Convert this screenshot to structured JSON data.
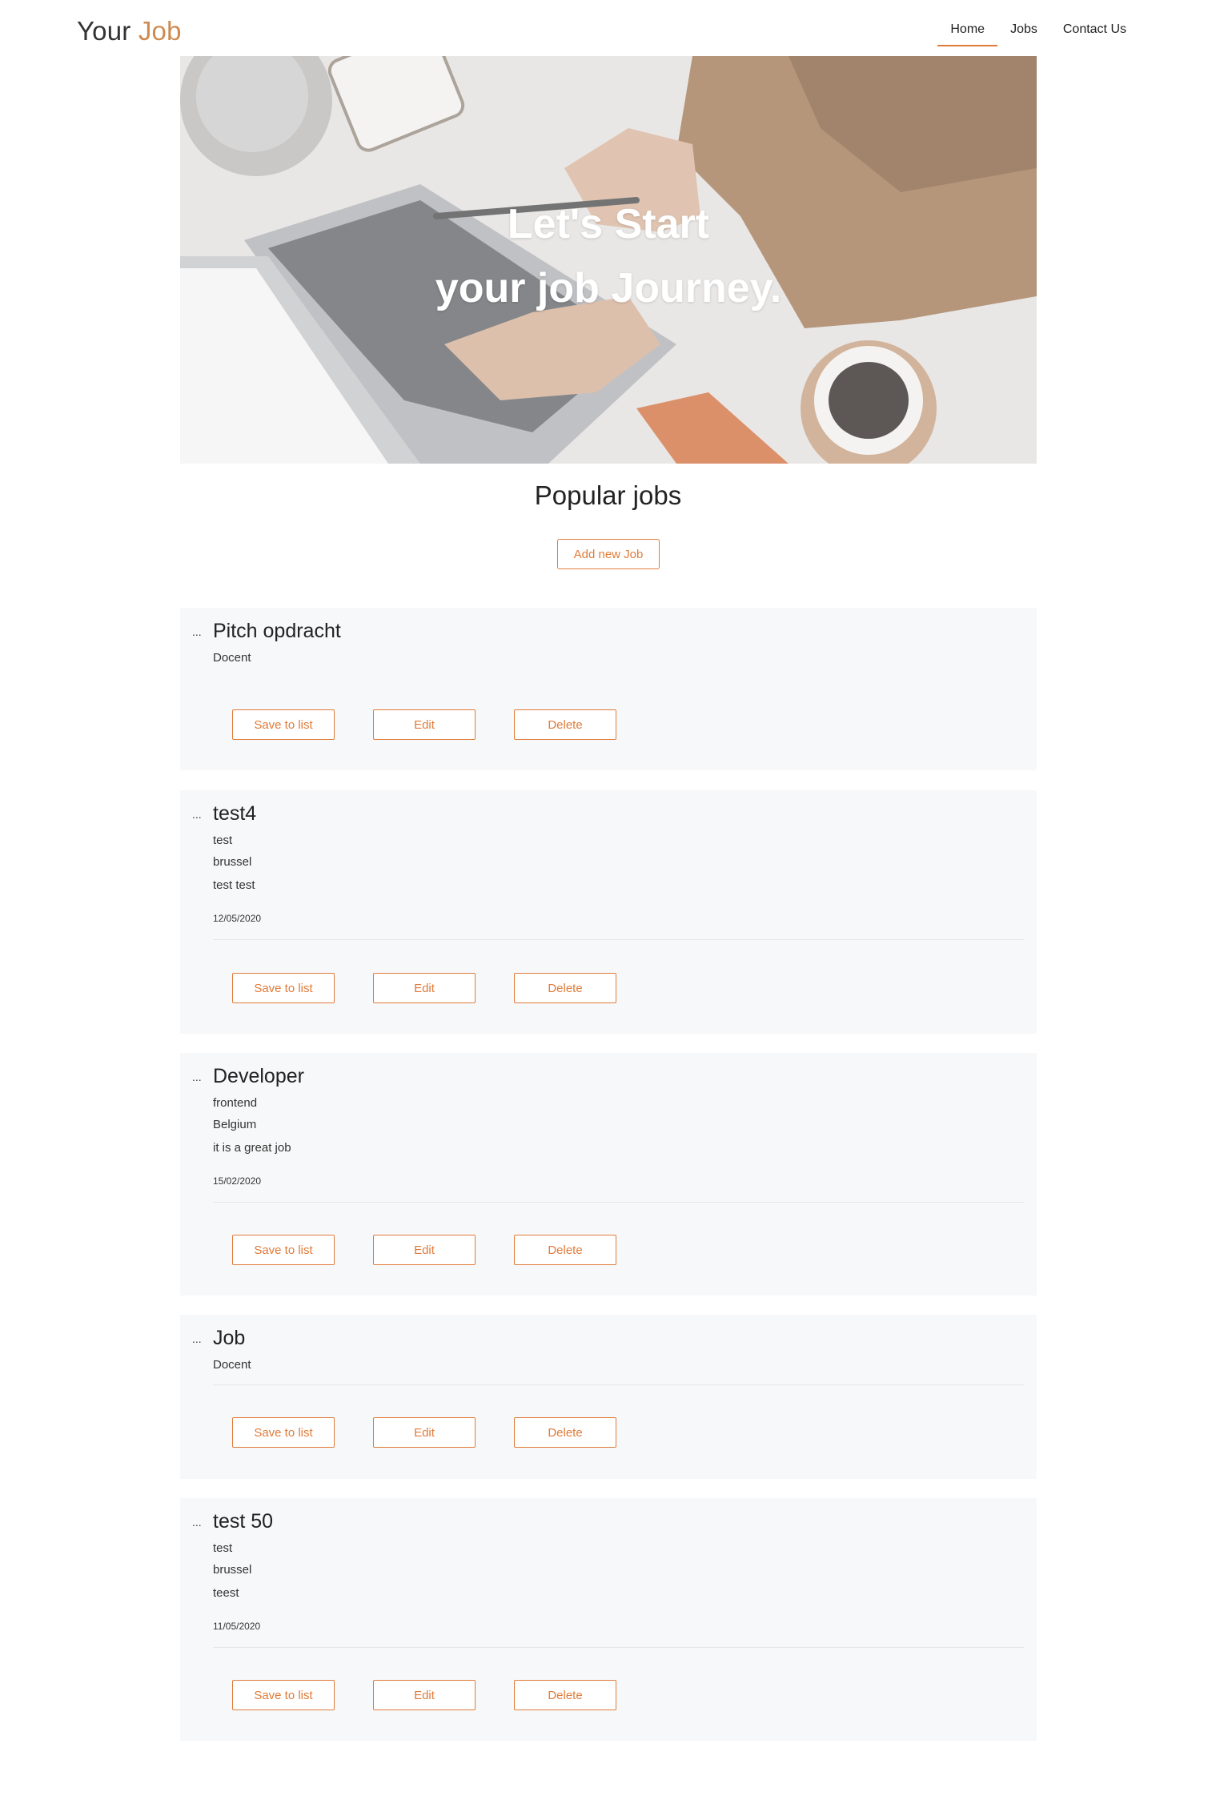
{
  "header": {
    "logo_part1": "Your",
    "logo_part2": "Job",
    "nav": [
      "Home",
      "Jobs",
      "Contact Us"
    ],
    "active_nav": "Home"
  },
  "hero": {
    "line1": "Let's Start",
    "line2": "your job Journey."
  },
  "main": {
    "section_title": "Popular jobs",
    "add_button": "Add new Job"
  },
  "buttons": {
    "save": "Save to list",
    "edit": "Edit",
    "delete": "Delete"
  },
  "dots": "...",
  "jobs": [
    {
      "title": "Pitch opdracht",
      "subtitle": "Docent"
    },
    {
      "title": "test4",
      "subtitle": "test",
      "location": "brussel",
      "description": "test test",
      "date": "12/05/2020"
    },
    {
      "title": "Developer",
      "subtitle": "frontend",
      "location": "Belgium",
      "description": "it is a great job",
      "date": "15/02/2020"
    },
    {
      "title": "Job",
      "subtitle": "Docent"
    },
    {
      "title": "test 50",
      "subtitle": "test",
      "location": "brussel",
      "description": "teest",
      "date": "11/05/2020"
    }
  ],
  "colors": {
    "accent": "#e07b39",
    "logo_accent": "#d08a4e",
    "card_bg": "#f7f8f9"
  }
}
